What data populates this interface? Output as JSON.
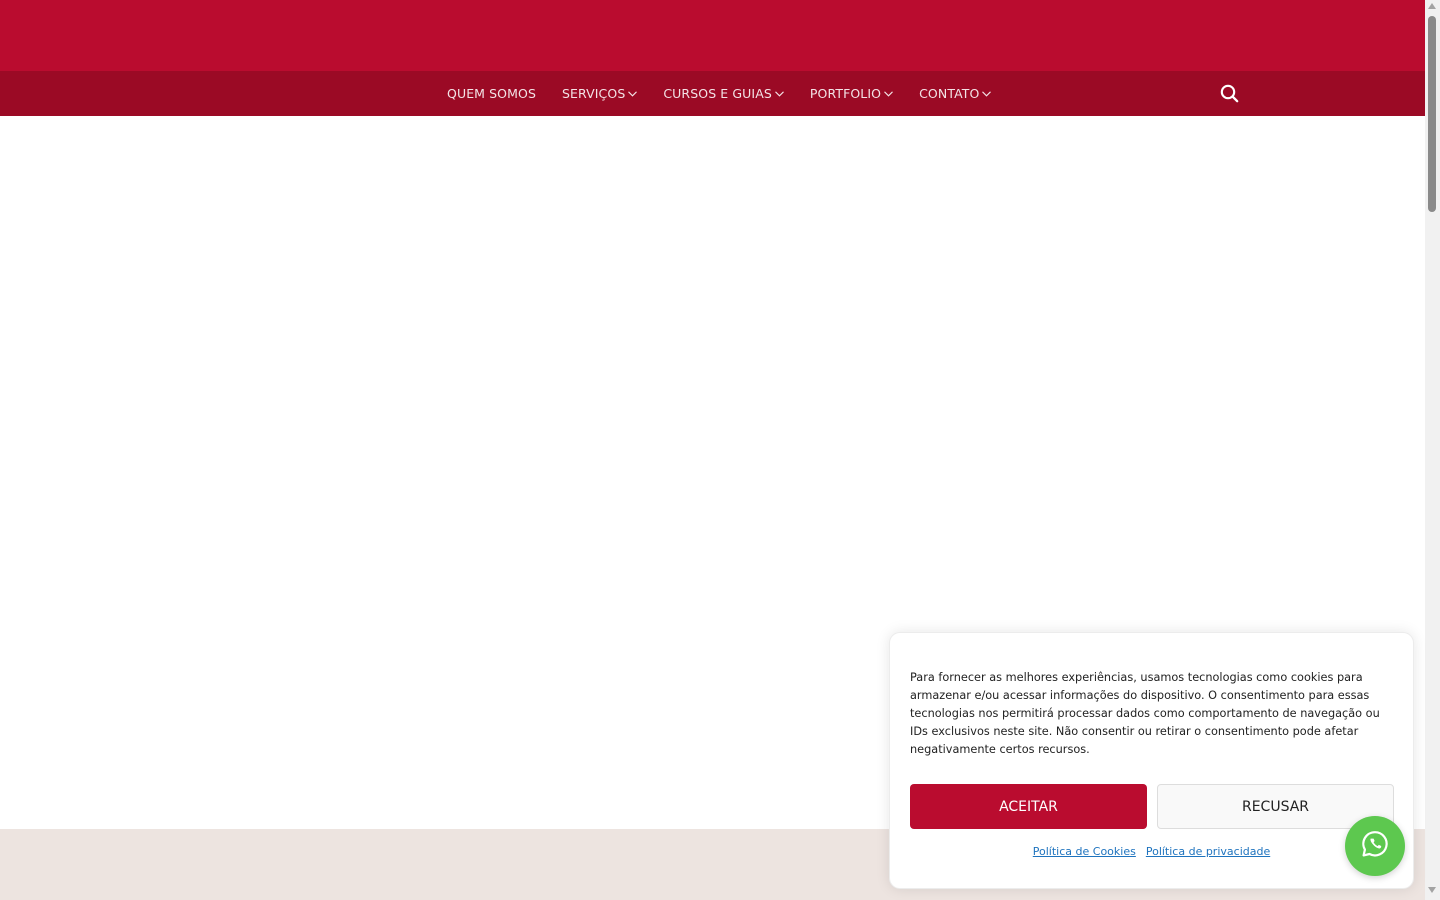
{
  "nav": {
    "items": [
      {
        "label": "QUEM SOMOS",
        "dropdown": false
      },
      {
        "label": "SERVIÇOS",
        "dropdown": true
      },
      {
        "label": "CURSOS E GUIAS",
        "dropdown": true
      },
      {
        "label": "PORTFOLIO",
        "dropdown": true
      },
      {
        "label": "CONTATO",
        "dropdown": true
      }
    ],
    "search_icon": "search-icon"
  },
  "cookie": {
    "text": "Para fornecer as melhores experiências, usamos tecnologias como cookies para armazenar e/ou acessar informações do dispositivo. O consentimento para essas tecnologias nos permitirá processar dados como comportamento de navegação ou IDs exclusivos neste site. Não consentir ou retirar o consentimento pode afetar negativamente certos recursos.",
    "accept_label": "ACEITAR",
    "deny_label": "RECUSAR",
    "links": [
      "Política de Cookies",
      "Política de privacidade"
    ]
  },
  "floating": {
    "whatsapp_icon": "whatsapp-icon"
  },
  "colors": {
    "brand": "#ba0c2f",
    "nav_bg": "#9b0a25",
    "footer_bg": "#ede4e0",
    "whatsapp": "#5dc84f",
    "link": "#1e73be"
  }
}
